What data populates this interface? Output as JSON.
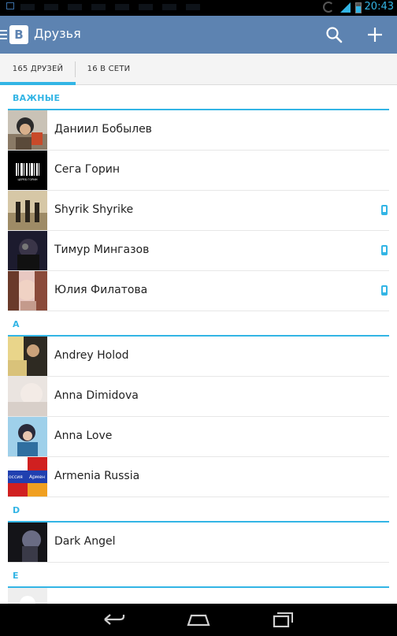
{
  "status_bar": {
    "time": "20:43",
    "icons": [
      "notification-icon",
      "sync-icon",
      "signal-icon",
      "battery-icon"
    ]
  },
  "app_bar": {
    "logo": "В",
    "title": "Друзья",
    "background": "#5d83b1",
    "icons": [
      "menu-icon",
      "search-icon",
      "add-icon"
    ]
  },
  "tabs": [
    {
      "label": "165 ДРУЗЕЙ",
      "selected": true
    },
    {
      "label": "16 В СЕТИ",
      "selected": false
    }
  ],
  "accent_color": "#33b5e5",
  "sections": [
    {
      "title": "ВАЖНЫЕ",
      "friends": [
        {
          "name": "Даниил Бобылев",
          "mobile": false
        },
        {
          "name": "Сега Горин",
          "mobile": false
        },
        {
          "name": "Shyrik Shyrike",
          "mobile": true
        },
        {
          "name": "Тимур Мингазов",
          "mobile": true
        },
        {
          "name": "Юлия Филатова",
          "mobile": true
        }
      ]
    },
    {
      "title": "A",
      "friends": [
        {
          "name": "Andrey Holod",
          "mobile": false
        },
        {
          "name": "Anna Dimidova",
          "mobile": false
        },
        {
          "name": "Anna Love",
          "mobile": false
        },
        {
          "name": "Armenia Russia",
          "mobile": false
        }
      ]
    },
    {
      "title": "D",
      "friends": [
        {
          "name": "Dark Angel",
          "mobile": false
        }
      ]
    },
    {
      "title": "E",
      "friends": [
        {
          "name": "",
          "mobile": false
        }
      ]
    }
  ],
  "avatar_texts": {
    "barcode_caption": "ЦЕРЕБ ГОРИН",
    "flag_left": "оссия",
    "flag_right": "Армен"
  },
  "nav_bar": {
    "icons": [
      "back-icon",
      "home-icon",
      "recents-icon"
    ]
  }
}
